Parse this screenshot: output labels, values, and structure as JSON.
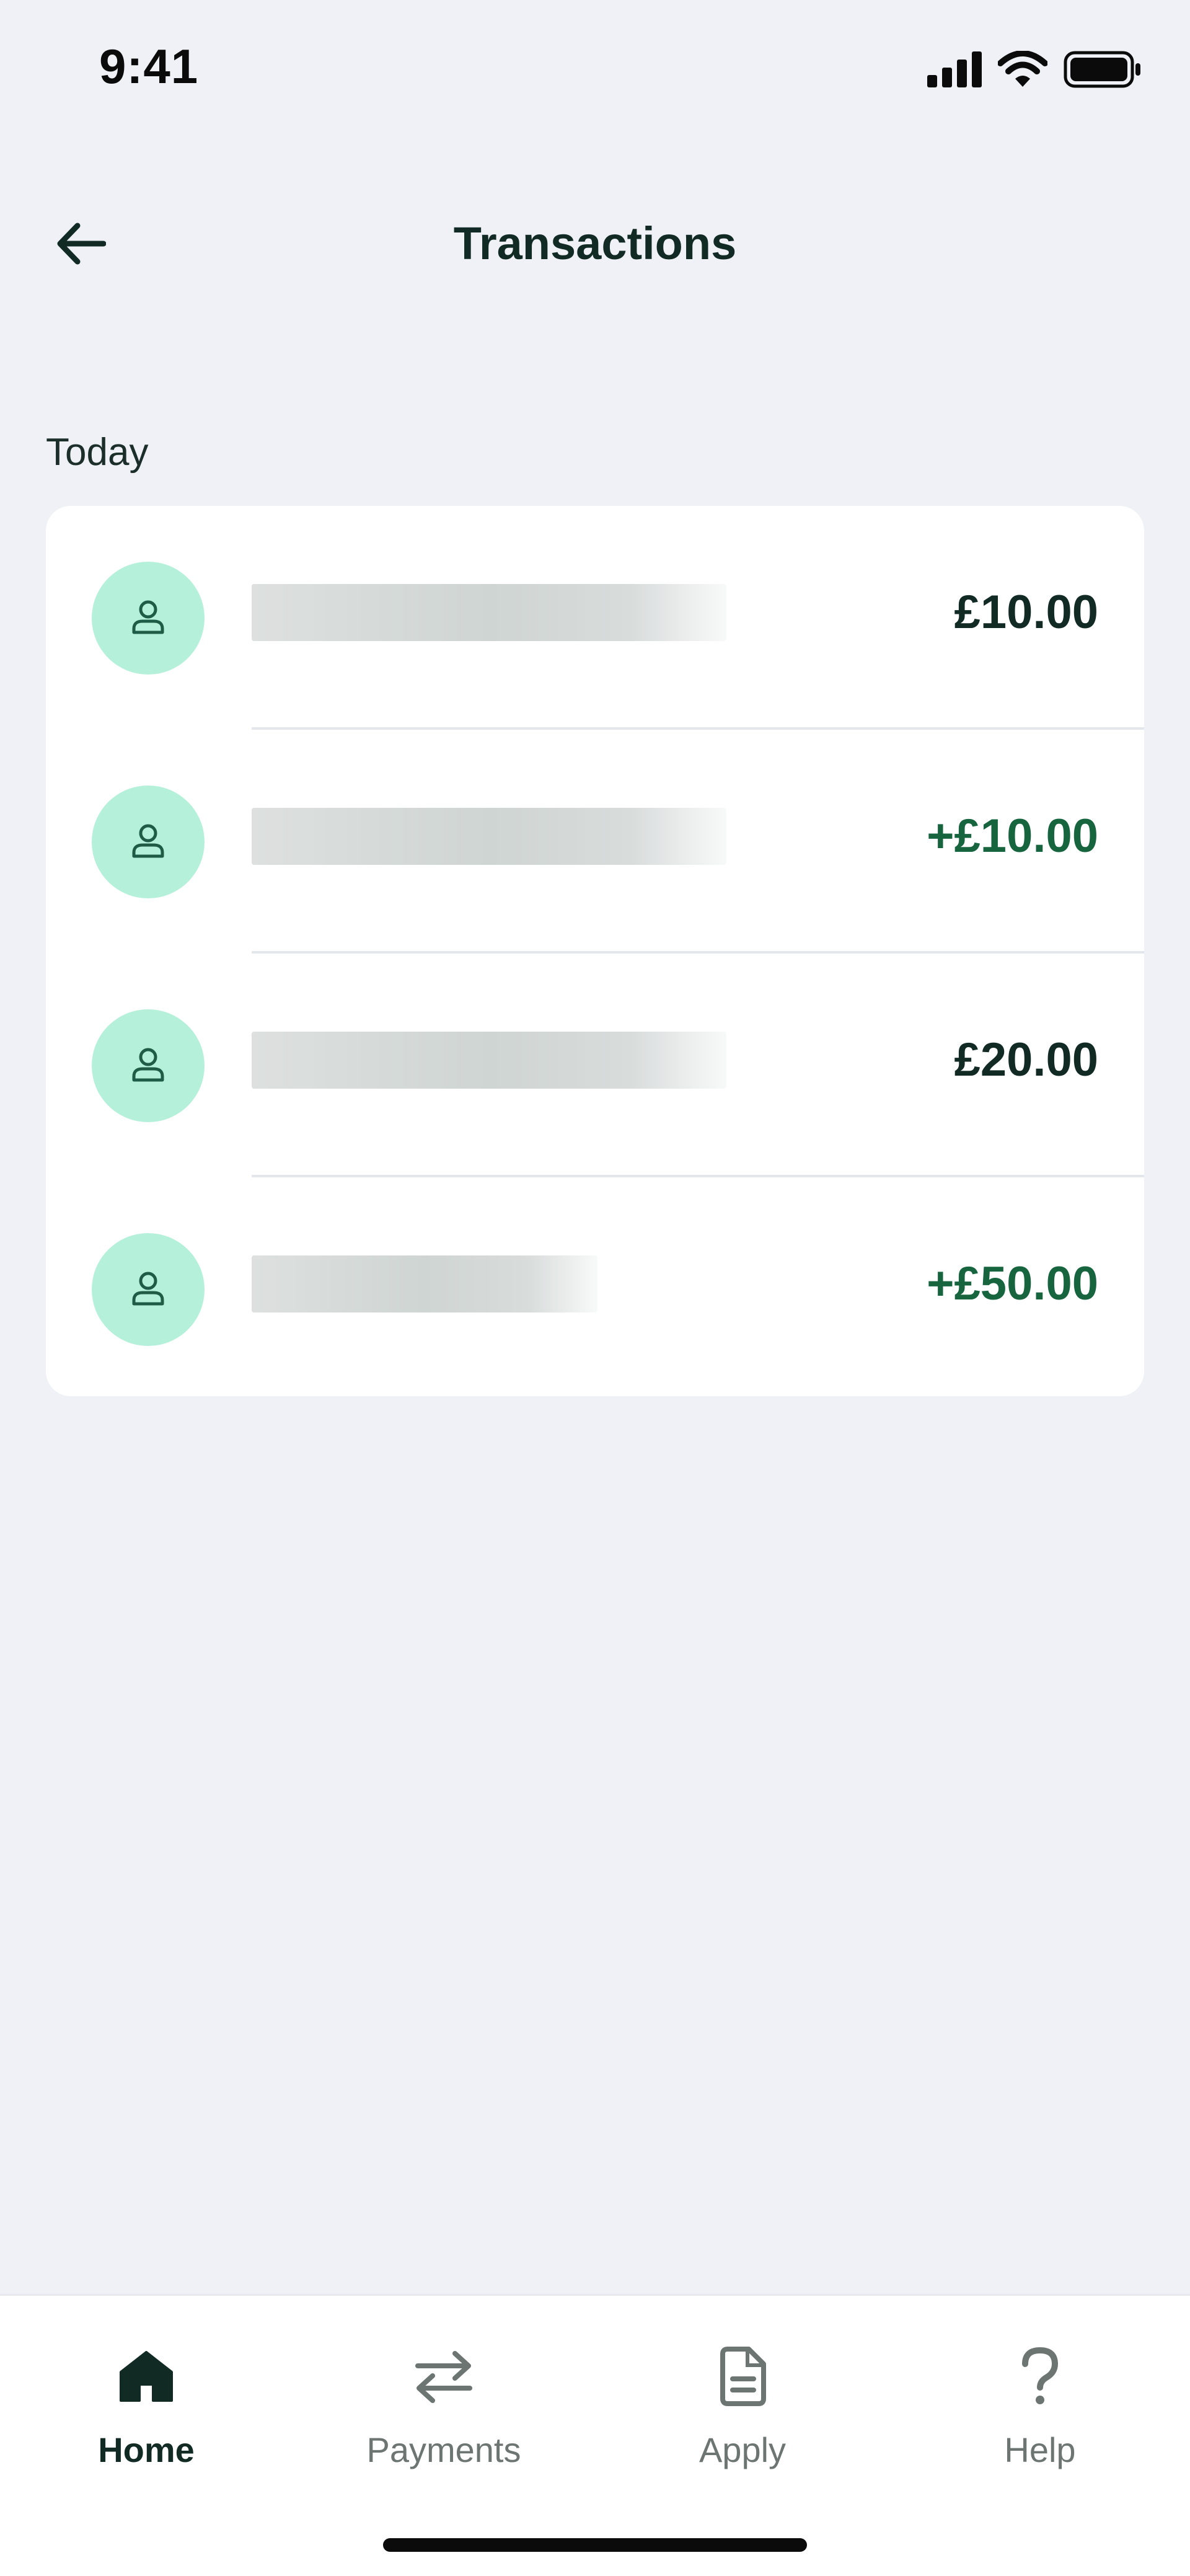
{
  "status_bar": {
    "time": "9:41"
  },
  "header": {
    "title": "Transactions",
    "back_icon": "arrow-left-icon"
  },
  "section": {
    "label": "Today"
  },
  "transactions": [
    {
      "avatar_icon": "person-icon",
      "name_redacted": true,
      "amount": "£10.00",
      "type": "debit"
    },
    {
      "avatar_icon": "person-icon",
      "name_redacted": true,
      "amount": "+£10.00",
      "type": "credit"
    },
    {
      "avatar_icon": "person-icon",
      "name_redacted": true,
      "amount": "£20.00",
      "type": "debit"
    },
    {
      "avatar_icon": "person-icon",
      "name_redacted": true,
      "amount": "+£50.00",
      "type": "credit"
    }
  ],
  "tab_bar": {
    "tabs": [
      {
        "label": "Home",
        "icon": "home-icon",
        "active": true
      },
      {
        "label": "Payments",
        "icon": "transfer-arrows-icon",
        "active": false
      },
      {
        "label": "Apply",
        "icon": "document-icon",
        "active": false
      },
      {
        "label": "Help",
        "icon": "question-mark-icon",
        "active": false
      }
    ]
  },
  "colors": {
    "background": "#eff1f6",
    "card": "#ffffff",
    "avatar_bg": "#b5f0da",
    "text_primary": "#112a24",
    "credit_green": "#17653e",
    "tab_inactive": "#6c7572"
  }
}
